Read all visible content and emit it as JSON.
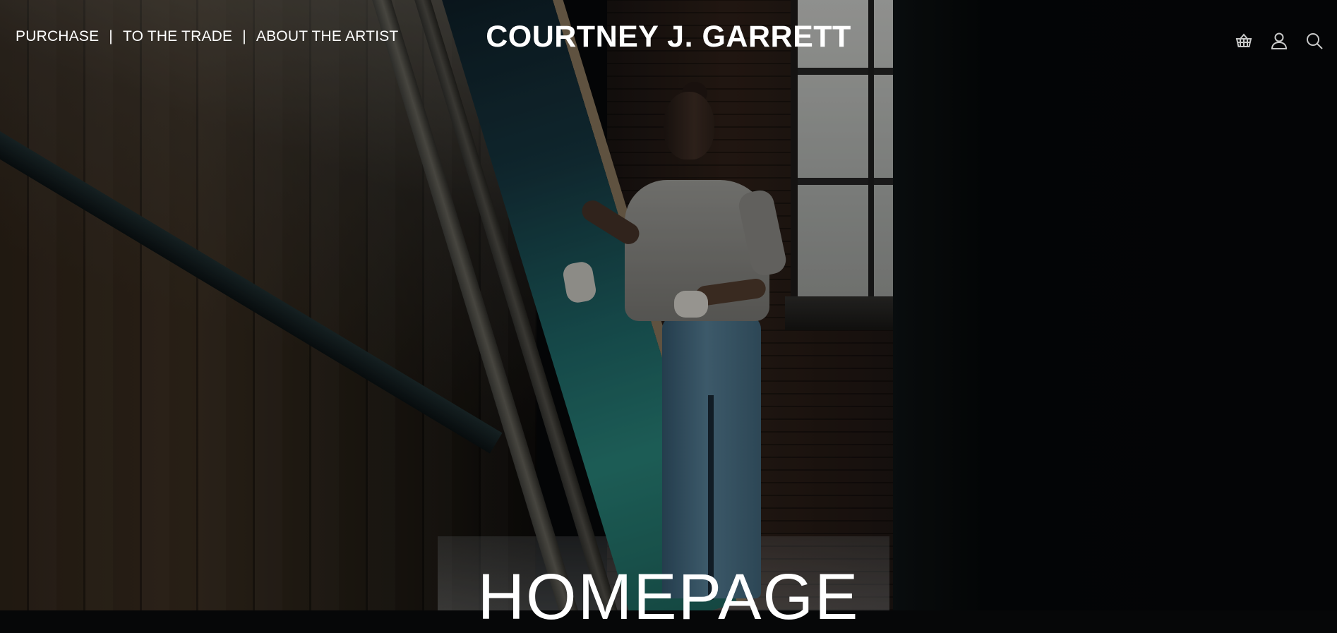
{
  "nav": {
    "items": [
      {
        "label": "PURCHASE"
      },
      {
        "label": "TO THE TRADE"
      },
      {
        "label": "ABOUT THE ARTIST"
      }
    ],
    "separator": "|"
  },
  "brand": {
    "name": "COURTNEY J. GARRETT"
  },
  "header_icons": [
    "basket-icon",
    "user-icon",
    "search-icon"
  ],
  "hero": {
    "heading": "HOMEPAGE"
  },
  "colors": {
    "text": "#ffffff",
    "icon": "#c8c9c8",
    "background": "#060708"
  }
}
